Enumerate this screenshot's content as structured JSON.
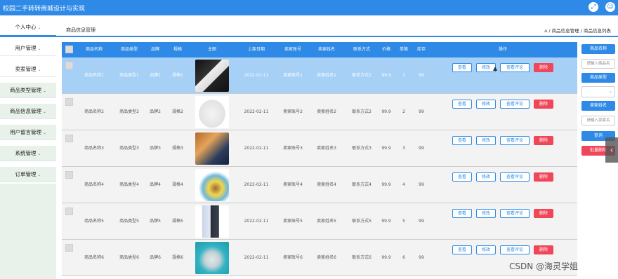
{
  "app": {
    "title": "校园二手转转商城设计与实现"
  },
  "sidebar": {
    "items": [
      {
        "label": "个人中心"
      },
      {
        "label": "用户管理"
      },
      {
        "label": "卖家管理"
      },
      {
        "label": "商品类型管理"
      },
      {
        "label": "商品信息管理"
      },
      {
        "label": "用户留言管理"
      },
      {
        "label": "系统管理"
      },
      {
        "label": "订单管理"
      }
    ],
    "chevron": "⌄"
  },
  "breadcrumb": {
    "page_title": "商品信息管理",
    "home_icon": "home-icon",
    "path": "⌂ / 商品信息管理 / 商品信息列表"
  },
  "table": {
    "headers": [
      "商品名称",
      "商品类型",
      "品牌",
      "规格",
      "主图",
      "上架日期",
      "卖家账号",
      "卖家姓名",
      "联系方式",
      "价格",
      "单限",
      "库存",
      "操作"
    ],
    "rows": [
      {
        "name": "商品名称1",
        "type": "商品类型1",
        "brand": "品牌1",
        "spec": "规格1",
        "date": "2022-02-11",
        "account": "卖家账号1",
        "seller": "卖家姓名1",
        "contact": "联系方式1",
        "price": "99.9",
        "limit": "1",
        "stock": "99",
        "image": "book"
      },
      {
        "name": "商品名称2",
        "type": "商品类型2",
        "brand": "品牌2",
        "spec": "规格2",
        "date": "2022-02-11",
        "account": "卖家账号2",
        "seller": "卖家姓名2",
        "contact": "联系方式2",
        "price": "99.9",
        "limit": "2",
        "stock": "99",
        "image": "tshirt"
      },
      {
        "name": "商品名称3",
        "type": "商品类型3",
        "brand": "品牌3",
        "spec": "规格3",
        "date": "2022-02-11",
        "account": "卖家账号3",
        "seller": "卖家姓名3",
        "contact": "联系方式3",
        "price": "99.9",
        "limit": "3",
        "stock": "99",
        "image": "tablet"
      },
      {
        "name": "商品名称4",
        "type": "商品类型4",
        "brand": "品牌4",
        "spec": "规格4",
        "date": "2022-02-11",
        "account": "卖家账号4",
        "seller": "卖家姓名4",
        "contact": "联系方式4",
        "price": "99.9",
        "limit": "4",
        "stock": "99",
        "image": "phone-colors"
      },
      {
        "name": "商品名称5",
        "type": "商品类型5",
        "brand": "品牌5",
        "spec": "规格5",
        "date": "2022-02-11",
        "account": "卖家账号5",
        "seller": "卖家姓名5",
        "contact": "联系方式5",
        "price": "99.9",
        "limit": "5",
        "stock": "99",
        "image": "phone"
      },
      {
        "name": "商品名称6",
        "type": "商品类型6",
        "brand": "品牌6",
        "spec": "规格6",
        "date": "2022-02-11",
        "account": "卖家账号6",
        "seller": "卖家姓名6",
        "contact": "联系方式6",
        "price": "99.9",
        "limit": "6",
        "stock": "99",
        "image": "kettle"
      }
    ],
    "actions": {
      "view": "查看",
      "edit": "修改",
      "review": "查看评论",
      "delete": "删除"
    }
  },
  "search_panel": {
    "product_name_label": "商品名称",
    "product_name_placeholder": "请输入商品名",
    "product_type_label": "商品类型",
    "seller_name_label": "卖家姓名",
    "seller_name_placeholder": "请输入卖家名",
    "search_button": "查询",
    "batch_delete_button": "批量删除"
  },
  "watermark": "CSDN @海灵学姐",
  "colors": {
    "primary": "#2e8ae6",
    "danger": "#f0465a",
    "selected_row": "#a6d0f5",
    "sidebar_green": "#e8f2ea"
  }
}
